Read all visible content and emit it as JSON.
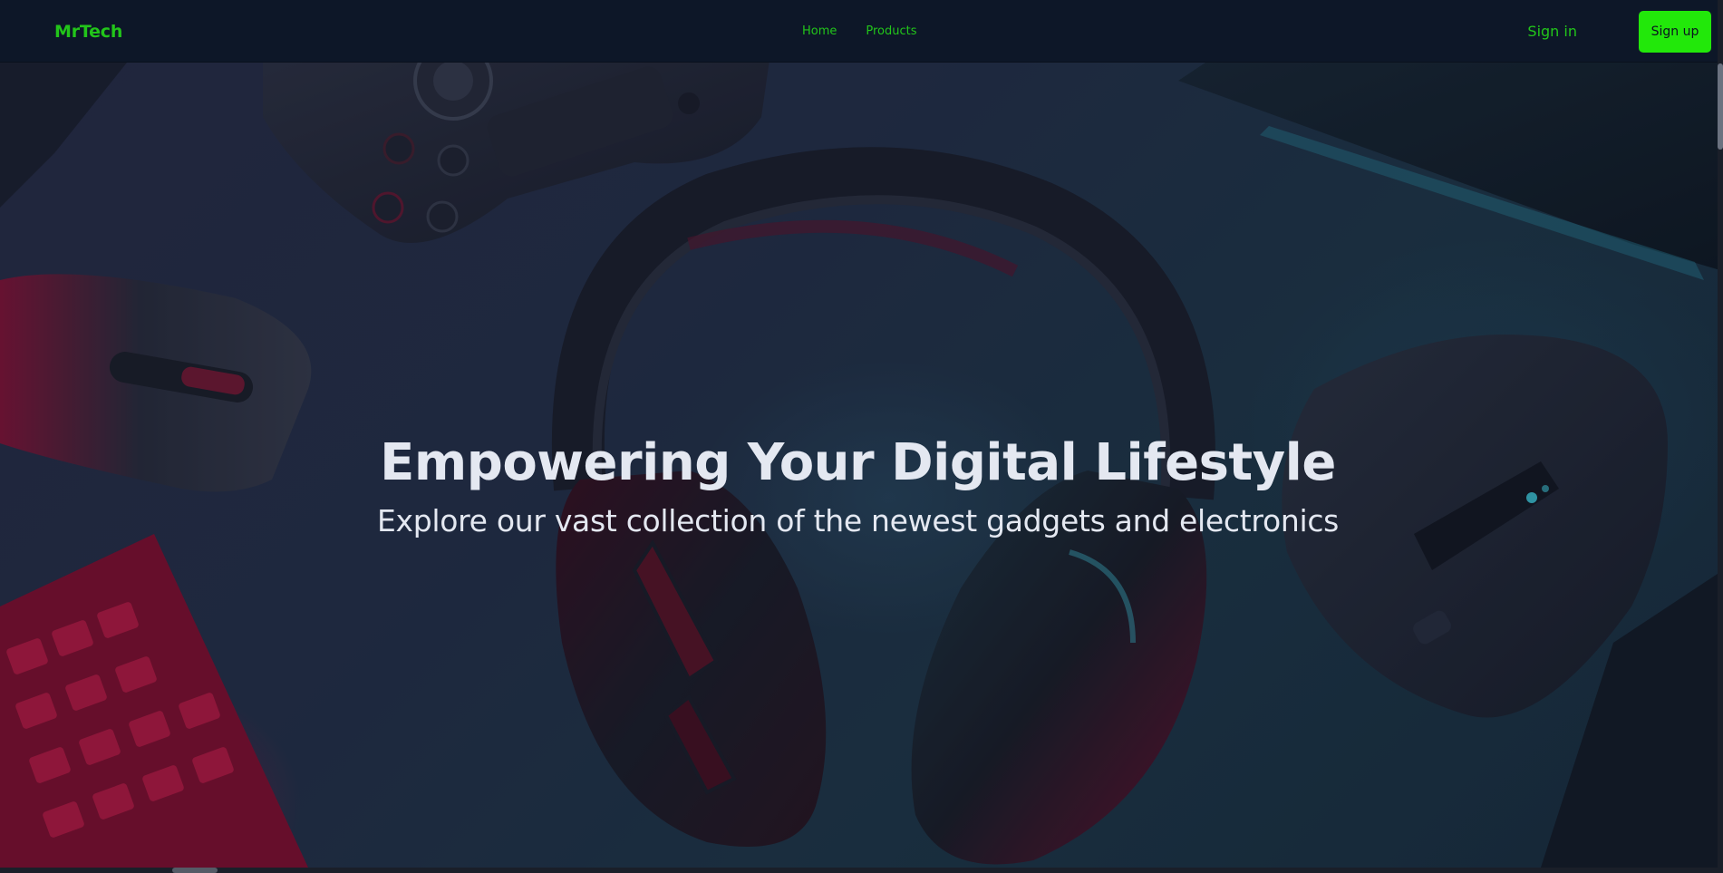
{
  "brand": {
    "name": "MrTech",
    "color": "#22c51a"
  },
  "nav": {
    "links": [
      {
        "label": "Home"
      },
      {
        "label": "Products"
      }
    ],
    "signin_label": "Sign in",
    "signup_label": "Sign up",
    "signup_color": "#22e80a"
  },
  "hero": {
    "title": "Empowering Your Digital Lifestyle",
    "subtitle": "Explore our vast collection of the newest gadgets and electronics",
    "background_image": "gaming-peripherals-photo"
  }
}
